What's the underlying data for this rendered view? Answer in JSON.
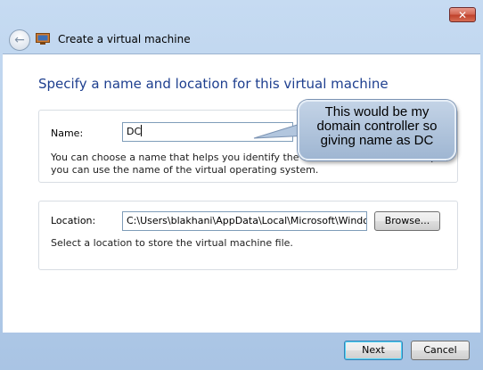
{
  "window": {
    "close_label": "✕",
    "title": "Create a virtual machine",
    "icons": [
      "back-arrow-icon",
      "virtual-machine-icon"
    ]
  },
  "page": {
    "heading": "Specify a name and location for this virtual machine"
  },
  "name_section": {
    "label": "Name:",
    "value": "DC",
    "help_line1": "You can choose a name that helps you identify the virtual machine. For example,",
    "help_line2": "you can use the name of the virtual operating system."
  },
  "location_section": {
    "label": "Location:",
    "value": "C:\\Users\\blakhani\\AppData\\Local\\Microsoft\\Windov",
    "browse_label": "Browse...",
    "help": "Select a location to store the virtual machine file."
  },
  "footer": {
    "next_label": "Next",
    "cancel_label": "Cancel"
  },
  "callout": {
    "line1": "This would be my",
    "line2": "domain controller so",
    "line3": "giving name as DC"
  },
  "colors": {
    "heading": "#1e3f8f",
    "frame": "#b9d1ea",
    "close_button": "#c0432c"
  }
}
